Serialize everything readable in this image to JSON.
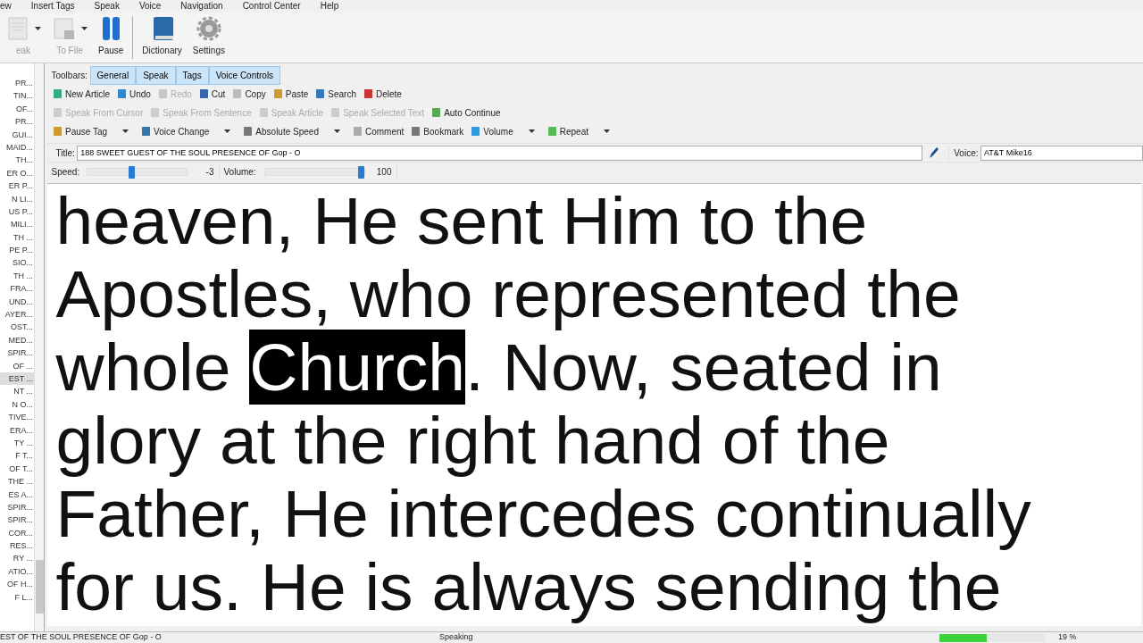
{
  "menu": [
    "ew",
    "Insert Tags",
    "Speak",
    "Voice",
    "Navigation",
    "Control Center",
    "Help"
  ],
  "ribbon": [
    {
      "label": "eak",
      "disabled": true,
      "dropdown": true
    },
    {
      "label": "To File",
      "disabled": true,
      "dropdown": true
    },
    {
      "label": "Pause",
      "disabled": false,
      "dropdown": false
    },
    {
      "label": "Dictionary",
      "disabled": false,
      "dropdown": false
    },
    {
      "label": "Settings",
      "disabled": false,
      "dropdown": false
    }
  ],
  "articles": [
    {
      "label": "PR...",
      "selected": false
    },
    {
      "label": "TIN...",
      "selected": false
    },
    {
      "label": "OF...",
      "selected": false
    },
    {
      "label": "PR...",
      "selected": false
    },
    {
      "label": "GUI...",
      "selected": false
    },
    {
      "label": "MAID...",
      "selected": false
    },
    {
      "label": "TH...",
      "selected": false
    },
    {
      "label": "ER O...",
      "selected": false
    },
    {
      "label": "ER P...",
      "selected": false
    },
    {
      "label": "N LI...",
      "selected": false
    },
    {
      "label": "US P...",
      "selected": false
    },
    {
      "label": "MILI...",
      "selected": false
    },
    {
      "label": "TH ...",
      "selected": false
    },
    {
      "label": "PE P...",
      "selected": false
    },
    {
      "label": "SIO...",
      "selected": false
    },
    {
      "label": "TH ...",
      "selected": false
    },
    {
      "label": "FRA...",
      "selected": false
    },
    {
      "label": "UND...",
      "selected": false
    },
    {
      "label": "AYER...",
      "selected": false
    },
    {
      "label": "OST...",
      "selected": false
    },
    {
      "label": "MED...",
      "selected": false
    },
    {
      "label": "SPIR...",
      "selected": false
    },
    {
      "label": "OF ...",
      "selected": false
    },
    {
      "label": "EST ...",
      "selected": true
    },
    {
      "label": "NT ...",
      "selected": false
    },
    {
      "label": "N O...",
      "selected": false
    },
    {
      "label": "TIVE...",
      "selected": false
    },
    {
      "label": "ERA...",
      "selected": false
    },
    {
      "label": "TY ...",
      "selected": false
    },
    {
      "label": "F T...",
      "selected": false
    },
    {
      "label": "OF T...",
      "selected": false
    },
    {
      "label": "THE ...",
      "selected": false
    },
    {
      "label": "ES A...",
      "selected": false
    },
    {
      "label": "SPIR...",
      "selected": false
    },
    {
      "label": "SPIR...",
      "selected": false
    },
    {
      "label": "COR...",
      "selected": false
    },
    {
      "label": "RES...",
      "selected": false
    },
    {
      "label": "RY ...",
      "selected": false
    },
    {
      "label": "ATIO...",
      "selected": false
    },
    {
      "label": "OF H...",
      "selected": false
    },
    {
      "label": "F L...",
      "selected": false
    }
  ],
  "toolbars_label": "Toolbars:",
  "toolbar_tabs": [
    {
      "label": "General",
      "selected": true
    },
    {
      "label": "Speak",
      "selected": true
    },
    {
      "label": "Tags",
      "selected": true
    },
    {
      "label": "Voice Controls",
      "selected": true
    }
  ],
  "toolbar_rows": [
    [
      {
        "label": "New Article",
        "disabled": false,
        "dropdown": false
      },
      {
        "label": "Undo",
        "disabled": false,
        "dropdown": false
      },
      {
        "label": "Redo",
        "disabled": true,
        "dropdown": false
      },
      {
        "label": "Cut",
        "disabled": false,
        "dropdown": false
      },
      {
        "label": "Copy",
        "disabled": false,
        "dropdown": false
      },
      {
        "label": "Paste",
        "disabled": false,
        "dropdown": false
      },
      {
        "label": "Search",
        "disabled": false,
        "dropdown": false
      },
      {
        "label": "Delete",
        "disabled": false,
        "dropdown": false
      }
    ],
    [
      {
        "label": "Speak From Cursor",
        "disabled": true,
        "dropdown": false
      },
      {
        "label": "Speak From Sentence",
        "disabled": true,
        "dropdown": false
      },
      {
        "label": "Speak Article",
        "disabled": true,
        "dropdown": false
      },
      {
        "label": "Speak Selected Text",
        "disabled": true,
        "dropdown": false
      },
      {
        "label": "Auto Continue",
        "disabled": false,
        "dropdown": false
      }
    ],
    [
      {
        "label": "Pause Tag",
        "disabled": false,
        "dropdown": true
      },
      {
        "label": "Voice Change",
        "disabled": false,
        "dropdown": true
      },
      {
        "label": "Absolute Speed",
        "disabled": false,
        "dropdown": true
      },
      {
        "label": "Comment",
        "disabled": false,
        "dropdown": false
      },
      {
        "label": "Bookmark",
        "disabled": false,
        "dropdown": false
      },
      {
        "label": "Volume",
        "disabled": false,
        "dropdown": true
      },
      {
        "label": "Repeat",
        "disabled": false,
        "dropdown": true
      }
    ]
  ],
  "title": {
    "label": "Title:",
    "value": "188 SWEET GUEST OF THE SOUL PRESENCE OF Gop - O"
  },
  "voice": {
    "label": "Voice:",
    "value": "AT&T Mike16"
  },
  "speed": {
    "label": "Speed:",
    "level": 0.45,
    "reading": "-3"
  },
  "volume": {
    "label": "Volume:",
    "level": 1,
    "reading": "100"
  },
  "text_segments": [
    {
      "text": "heaven, He sent Him to the Apostles, who represented the whole ",
      "highlighted": false
    },
    {
      "text": "Church",
      "highlighted": true
    },
    {
      "text": ". Now, seated in glory at the right hand of the Father, He intercedes continually for us. He is always sending the",
      "highlighted": false
    }
  ],
  "status_bar": {
    "article": "EST OF THE SOUL PRESENCE OF Gop - O",
    "state": "Speaking",
    "progress": {
      "level": 0.45
    },
    "percent": "19 %"
  }
}
